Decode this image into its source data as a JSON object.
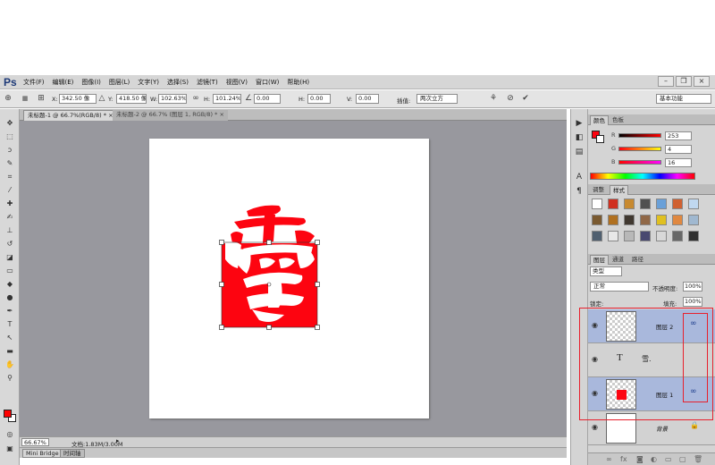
{
  "app": {
    "logo": "Ps"
  },
  "menu": [
    "文件(F)",
    "编辑(E)",
    "图像(I)",
    "图层(L)",
    "文字(Y)",
    "选择(S)",
    "滤镜(T)",
    "视图(V)",
    "窗口(W)",
    "帮助(H)"
  ],
  "window_controls": {
    "min": "–",
    "restore": "❐",
    "close": "×"
  },
  "options": {
    "x_label": "X:",
    "x_value": "342.50 像",
    "y_label": "Y:",
    "y_value": "418.50 像",
    "w_label": "W:",
    "w_value": "102.63%",
    "h_label": "H:",
    "h_value": "101.24%",
    "angle_value": "0.00",
    "hskew_label": "H:",
    "hskew_value": "0.00",
    "vskew_label": "V:",
    "vskew_value": "0.00",
    "interp_label": "插值:",
    "interp_value": "两次立方",
    "workspace": "基本功能"
  },
  "doc_tabs": [
    {
      "label": "未标题-1 @ 66.7%(RGB/8) *",
      "close": "×"
    },
    {
      "label": "未标题-2 @ 66.7% (图层 1, RGB/8) *",
      "close": "×"
    }
  ],
  "status": {
    "zoom": "66.67%",
    "doc": "文档:1.83M/3.00M"
  },
  "bottom_tabs": [
    "Mini Bridge",
    "时间轴"
  ],
  "color_panel": {
    "tabs": [
      "颜色",
      "色板"
    ],
    "r_label": "R",
    "r": "253",
    "g_label": "G",
    "g": "4",
    "b_label": "B",
    "b": "16",
    "fg": "#fd0410"
  },
  "styles_panel": {
    "tabs": [
      "调整",
      "样式"
    ]
  },
  "layers_panel": {
    "tabs": [
      "图层",
      "通道",
      "路径"
    ],
    "filter": "类型",
    "blend_mode": "正常",
    "opacity_label": "不透明度:",
    "opacity": "100%",
    "lock_label": "锁定:",
    "fill_label": "填充:",
    "fill": "100%",
    "layers": [
      {
        "name": "图层 2",
        "selected": true
      },
      {
        "name": "",
        "type_icon": "T",
        "selected": false
      },
      {
        "name": "图层 1",
        "selected": true
      },
      {
        "name": "背景",
        "selected": false
      }
    ]
  },
  "accent": {
    "red": "#ff0000",
    "highlight": "#e8202c",
    "selection": "#a9b8dc"
  }
}
